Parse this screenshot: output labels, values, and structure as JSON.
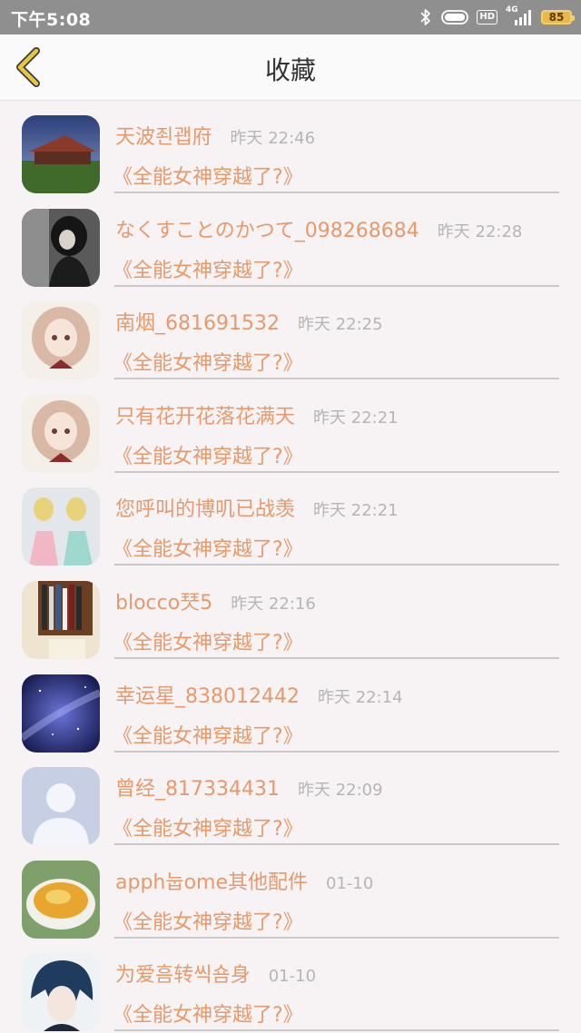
{
  "status_bar": {
    "time": "下午5:08",
    "hd_label": "HD",
    "network_label": "4G",
    "battery": "85",
    "icons": [
      "bluetooth-icon",
      "alarm-toggle-icon",
      "hd-icon",
      "signal-icon",
      "battery-icon"
    ]
  },
  "header": {
    "title": "收藏",
    "back_icon": "chevron-left-icon"
  },
  "colors": {
    "accent": "#e59a6c",
    "back_icon": "#e8c640",
    "time_text": "#b5b5b5",
    "status_bar": "#8f8f8f"
  },
  "items": [
    {
      "username": "天波죈괩府",
      "time": "昨天 22:46",
      "book": "《全能女神穿越了?》",
      "avatar": "landscape-avatar"
    },
    {
      "username": "なくすことのかつて_098268684",
      "time": "昨天 22:28",
      "book": "《全能女神穿越了?》",
      "avatar": "dark-girl-avatar"
    },
    {
      "username": "南烟_681691532",
      "time": "昨天 22:25",
      "book": "《全能女神穿越了?》",
      "avatar": "anime-girl-avatar"
    },
    {
      "username": "只有花开花落花满天",
      "time": "昨天 22:21",
      "book": "《全能女神穿越了?》",
      "avatar": "anime-girl-avatar"
    },
    {
      "username": "您呼叫的博叽已战羡",
      "time": "昨天 22:21",
      "book": "《全能女神穿越了?》",
      "avatar": "girls-photo-avatar"
    },
    {
      "username": "blocco珡5",
      "time": "昨天 22:16",
      "book": "《全能女神穿越了?》",
      "avatar": "bookshelf-avatar"
    },
    {
      "username": "幸运星_838012442",
      "time": "昨天 22:14",
      "book": "《全能女神穿越了?》",
      "avatar": "galaxy-avatar"
    },
    {
      "username": "曾经_817334431",
      "time": "昨天 22:09",
      "book": "《全能女神穿越了?》",
      "avatar": "default-user-avatar"
    },
    {
      "username": "apph눕ome其他配件",
      "time": "01-10",
      "book": "《全能女神穿越了?》",
      "avatar": "food-dish-avatar"
    },
    {
      "username": "为爱흠转씩숌身",
      "time": "01-10",
      "book": "《全能女神穿越了?》",
      "avatar": "anime-boy-avatar"
    }
  ]
}
